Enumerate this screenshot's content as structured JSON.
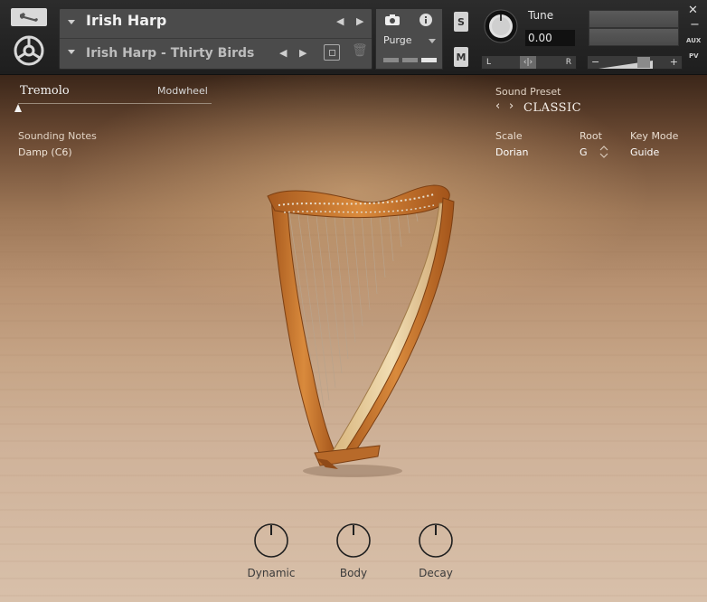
{
  "header": {
    "instrument_name": "Irish Harp",
    "preset_name": "Irish Harp - Thirty Birds",
    "purge_label": "Purge",
    "solo_label": "S",
    "mute_label": "M",
    "tune_label": "Tune",
    "tune_value": "0.00",
    "pan_left_label": "L",
    "pan_right_label": "R",
    "vol_minus_label": "−",
    "vol_plus_label": "+",
    "close_label": "✕",
    "minimize_label": "−",
    "aux_label": "AUX",
    "pv_label": "PV"
  },
  "controls": {
    "tremolo_label": "Tremolo",
    "modwheel_label": "Modwheel",
    "sounding_notes_label": "Sounding Notes",
    "sounding_notes_value": "Damp (C6)",
    "sound_preset_label": "Sound Preset",
    "sound_preset_value": "CLASSIC",
    "scale_label": "Scale",
    "scale_value": "Dorian",
    "root_label": "Root",
    "root_value": "G",
    "key_mode_label": "Key Mode",
    "key_mode_value": "Guide"
  },
  "knobs": [
    {
      "label": "Dynamic"
    },
    {
      "label": "Body"
    },
    {
      "label": "Decay"
    }
  ],
  "colors": {
    "header_bg": "#232323",
    "panel_bg": "#4b4b4b",
    "text_light": "#f0f0f0",
    "knob_label": "#3a3a3a",
    "harp_wood": "#c9782f",
    "harp_light_wood": "#ead3a4"
  },
  "icons": [
    "wrench-icon",
    "kontakt-logo-icon",
    "camera-icon",
    "info-icon",
    "save-icon",
    "trash-icon",
    "dropdown-arrow-icon",
    "chevron-left-icon",
    "chevron-right-icon"
  ]
}
